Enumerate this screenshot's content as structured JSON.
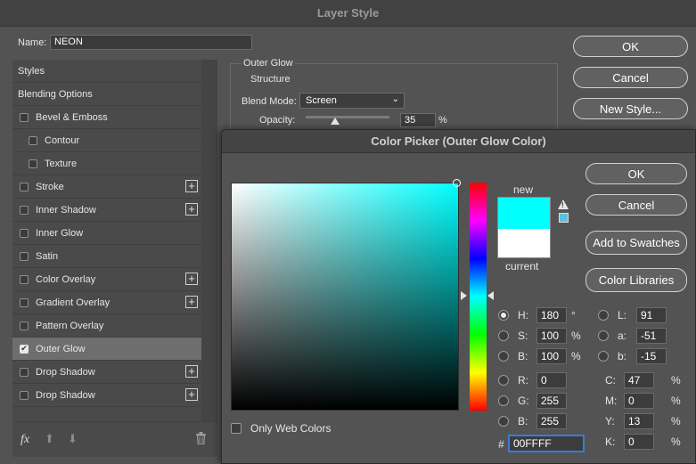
{
  "layer_style": {
    "title": "Layer Style",
    "name_label": "Name:",
    "name_value": "NEON",
    "buttons": {
      "ok": "OK",
      "cancel": "Cancel",
      "new_style": "New Style..."
    },
    "styles_list": [
      {
        "label": "Styles",
        "type": "header"
      },
      {
        "label": "Blending Options",
        "type": "header"
      },
      {
        "label": "Bevel & Emboss",
        "checked": false,
        "plus": false,
        "indent": 0
      },
      {
        "label": "Contour",
        "checked": false,
        "plus": false,
        "indent": 1
      },
      {
        "label": "Texture",
        "checked": false,
        "plus": false,
        "indent": 1
      },
      {
        "label": "Stroke",
        "checked": false,
        "plus": true,
        "indent": 0
      },
      {
        "label": "Inner Shadow",
        "checked": false,
        "plus": true,
        "indent": 0
      },
      {
        "label": "Inner Glow",
        "checked": false,
        "plus": false,
        "indent": 0
      },
      {
        "label": "Satin",
        "checked": false,
        "plus": false,
        "indent": 0
      },
      {
        "label": "Color Overlay",
        "checked": false,
        "plus": true,
        "indent": 0
      },
      {
        "label": "Gradient Overlay",
        "checked": false,
        "plus": true,
        "indent": 0
      },
      {
        "label": "Pattern Overlay",
        "checked": false,
        "plus": false,
        "indent": 0
      },
      {
        "label": "Outer Glow",
        "checked": true,
        "plus": false,
        "indent": 0,
        "selected": true
      },
      {
        "label": "Drop Shadow",
        "checked": false,
        "plus": true,
        "indent": 0
      },
      {
        "label": "Drop Shadow",
        "checked": false,
        "plus": true,
        "indent": 0
      }
    ],
    "footer_icons": [
      "fx-icon",
      "move-up-icon",
      "move-down-icon",
      "trash-icon"
    ],
    "fx_label": "fx",
    "outer_glow": {
      "section_title": "Outer Glow",
      "subsection_title": "Structure",
      "blend_mode_label": "Blend Mode:",
      "blend_mode_value": "Screen",
      "opacity_label": "Opacity:",
      "opacity_value": "35",
      "opacity_fraction": 0.35,
      "opacity_unit": "%"
    }
  },
  "color_picker": {
    "title": "Color Picker (Outer Glow Color)",
    "buttons": {
      "ok": "OK",
      "cancel": "Cancel",
      "add_to_swatches": "Add to Swatches",
      "color_libraries": "Color Libraries"
    },
    "new_label": "new",
    "current_label": "current",
    "new_color": "#00ffff",
    "current_color": "#ffffff",
    "web_safe_swatch_color": "#5bc0de",
    "only_web_colors_label": "Only Web Colors",
    "fields": {
      "H": {
        "label": "H:",
        "value": "180",
        "unit": "°",
        "selected": true
      },
      "S": {
        "label": "S:",
        "value": "100",
        "unit": "%"
      },
      "Bv": {
        "label": "B:",
        "value": "100",
        "unit": "%"
      },
      "R": {
        "label": "R:",
        "value": "0"
      },
      "G": {
        "label": "G:",
        "value": "255"
      },
      "Bc": {
        "label": "B:",
        "value": "255"
      },
      "L": {
        "label": "L:",
        "value": "91"
      },
      "a": {
        "label": "a:",
        "value": "-51"
      },
      "b": {
        "label": "b:",
        "value": "-15"
      },
      "C": {
        "label": "C:",
        "value": "47",
        "unit": "%"
      },
      "M": {
        "label": "M:",
        "value": "0",
        "unit": "%"
      },
      "Y": {
        "label": "Y:",
        "value": "13",
        "unit": "%"
      },
      "K": {
        "label": "K:",
        "value": "0",
        "unit": "%"
      }
    },
    "hex_label": "#",
    "hex_value": "00FFFF"
  }
}
